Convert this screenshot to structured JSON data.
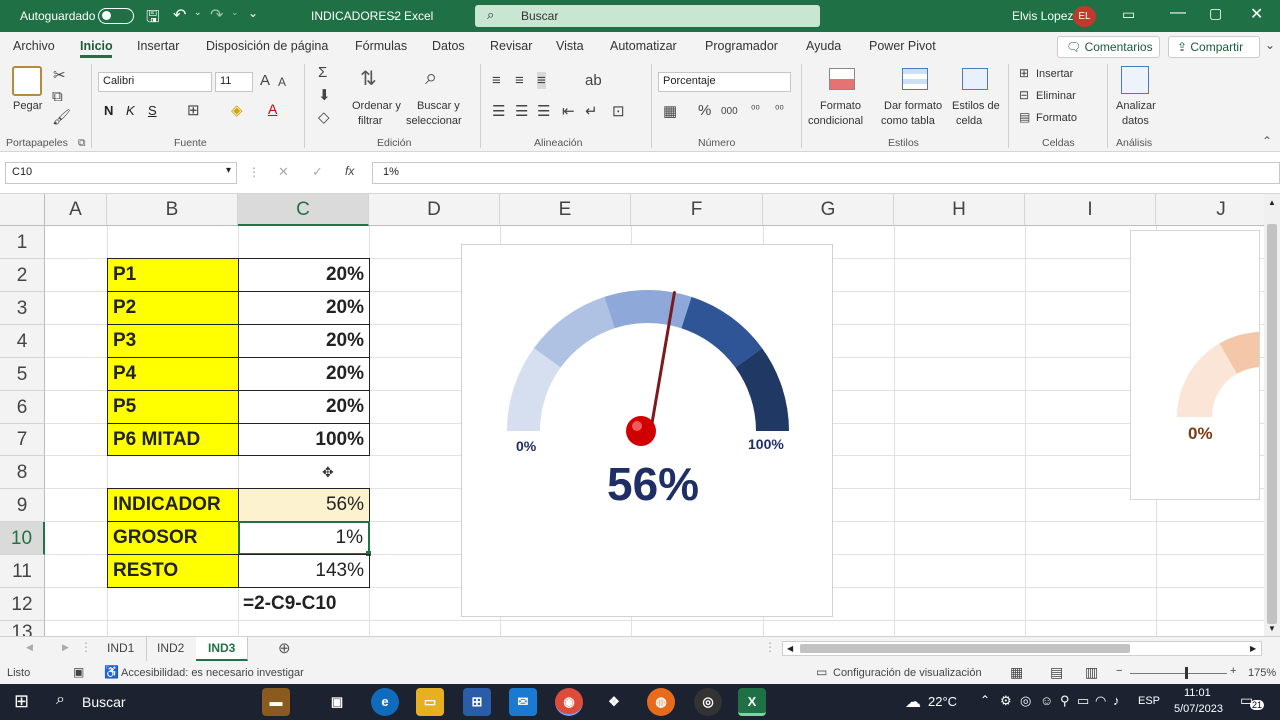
{
  "titlebar": {
    "autosave_label": "Autoguardado",
    "file_name": "INDICADORES2",
    "separator": "-",
    "app_name": "Excel",
    "search_label": "Buscar",
    "user_name": "Elvis Lopez",
    "user_initials": "EL"
  },
  "menu": {
    "items": [
      "Archivo",
      "Inicio",
      "Insertar",
      "Disposición de página",
      "Fórmulas",
      "Datos",
      "Revisar",
      "Vista",
      "Automatizar",
      "Programador",
      "Ayuda",
      "Power Pivot"
    ],
    "active": "Inicio",
    "comments_label": "Comentarios",
    "share_label": "Compartir"
  },
  "ribbon": {
    "paste_label": "Pegar",
    "font_name": "Calibri",
    "font_size": "11",
    "bold": "N",
    "italic": "K",
    "underline": "S",
    "sort_filter_1": "Ordenar y",
    "sort_filter_2": "filtrar",
    "find_select_1": "Buscar y",
    "find_select_2": "seleccionar",
    "number_format": "Porcentaje",
    "cond_format_1": "Formato",
    "cond_format_2": "condicional",
    "table_format_1": "Dar formato",
    "table_format_2": "como tabla",
    "cell_styles_1": "Estilos de",
    "cell_styles_2": "celda",
    "insert_label": "Insertar",
    "delete_label": "Eliminar",
    "format_label": "Formato",
    "analyze_1": "Analizar",
    "analyze_2": "datos",
    "groups": {
      "clipboard": "Portapapeles",
      "font": "Fuente",
      "editing": "Edición",
      "alignment": "Alineación",
      "number": "Número",
      "styles": "Estilos",
      "cells": "Celdas",
      "analysis": "Análisis"
    }
  },
  "formula_bar": {
    "name_box": "C10",
    "fx_label": "fx",
    "formula": "1%"
  },
  "columns": [
    "A",
    "B",
    "C",
    "D",
    "E",
    "F",
    "G",
    "H",
    "I",
    "J"
  ],
  "rows": [
    "1",
    "2",
    "3",
    "4",
    "5",
    "6",
    "7",
    "8",
    "9",
    "10",
    "11",
    "12",
    "13"
  ],
  "selected_cell": {
    "column": "C",
    "row": "10"
  },
  "table": [
    {
      "label": "P1",
      "value": "20%"
    },
    {
      "label": "P2",
      "value": "20%"
    },
    {
      "label": "P3",
      "value": "20%"
    },
    {
      "label": "P4",
      "value": "20%"
    },
    {
      "label": "P5",
      "value": "20%"
    },
    {
      "label": "P6 MITAD",
      "value": "100%"
    }
  ],
  "indicators": [
    {
      "label": "INDICADOR",
      "value": "56%"
    },
    {
      "label": "GROSOR",
      "value": "1%"
    },
    {
      "label": "RESTO",
      "value": "143%"
    }
  ],
  "formula_note": "=2-C9-C10",
  "gauge": {
    "min_label": "0%",
    "max_label": "100%",
    "value_label": "56%",
    "value": 0.56,
    "segment_colors": [
      "#d6dff0",
      "#b0c2e4",
      "#8ea8da",
      "#2f5597",
      "#1f3864"
    ],
    "needle_color": "#7b1c1c",
    "value_color": "#1f2f66"
  },
  "gauge2": {
    "min_label": "0%",
    "segment_colors": [
      "#fbe5d6",
      "#f4c7a8",
      "#eea882"
    ]
  },
  "sheets": {
    "tabs": [
      "IND1",
      "IND2",
      "IND3"
    ],
    "active": "IND3"
  },
  "status": {
    "ready": "Listo",
    "accessibility": "Accesibilidad: es necesario investigar",
    "display_settings": "Configuración de visualización",
    "zoom": "175%"
  },
  "taskbar": {
    "search_label": "Buscar",
    "temperature": "22°C",
    "language": "ESP",
    "time": "11:01",
    "date": "5/07/2023",
    "notifications": "21"
  }
}
